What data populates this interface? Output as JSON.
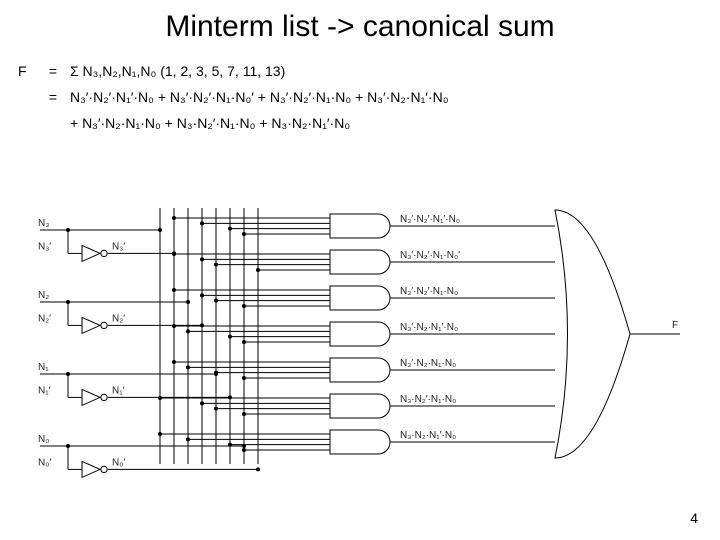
{
  "title": "Minterm list -> canonical sum",
  "pagenum": "4",
  "equation": {
    "lhs": "F",
    "eq": "=",
    "line1": "Σ N₃,N₂,N₁,N₀ (1, 2, 3, 5, 7, 11, 13)",
    "line2": "N₃′·N₂′·N₁′·N₀ + N₃′·N₂′·N₁·N₀′ + N₃′·N₂′·N₁·N₀ + N₃′·N₂·N₁′·N₀",
    "line3": "+ N₃′·N₂·N₁·N₀ + N₃·N₂′·N₁·N₀ + N₃·N₂·N₁′·N₀"
  },
  "inputs": [
    "N₃",
    "N₃′",
    "N₂",
    "N₂′",
    "N₁",
    "N₁′",
    "N₀",
    "N₀′"
  ],
  "and_labels": [
    "N₃′·N₂′·N₁′·N₀",
    "N₃′·N₂′·N₁·N₀′",
    "N₃′·N₂′·N₁·N₀",
    "N₃′·N₂·N₁′·N₀",
    "N₃′·N₂·N₁·N₀",
    "N₃·N₂′·N₁·N₀",
    "N₃·N₂·N₁′·N₀"
  ],
  "output": "F"
}
